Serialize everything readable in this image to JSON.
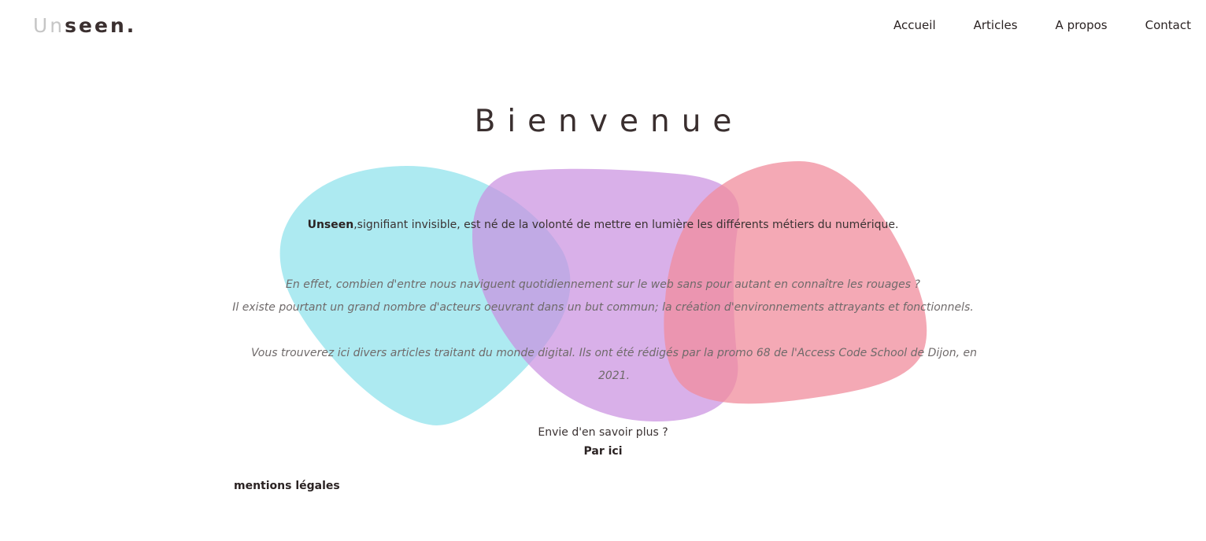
{
  "header": {
    "logo_light": "Un",
    "logo_dark": "seen",
    "logo_dot": ".",
    "nav": [
      "Accueil",
      "Articles",
      "A propos",
      "Contact"
    ]
  },
  "hero": {
    "title": "Bienvenue",
    "intro_brand": "Unseen",
    "intro_rest": ",signifiant invisible, est né de la volonté de mettre en lumière les différents métiers du numérique.",
    "para1_line1": "En effet, combien d'entre nous naviguent quotidiennement sur le web sans pour autant en connaître les rouages ?",
    "para1_line2": "Il existe pourtant un grand nombre d'acteurs oeuvrant dans un but commun; la création d'environnements attrayants et fonctionnels.",
    "para2": "Vous trouverez ici divers articles traitant du monde digital. Ils ont été rédigés par la promo 68 de l'Access Code School de Dijon, en 2021.",
    "more_question": "Envie d'en savoir plus ?",
    "more_link": "Par ici"
  },
  "footer": {
    "legal": "mentions légales"
  },
  "colors": {
    "blob_cyan": "#9fe6ef",
    "blob_purple": "#d3a6e4",
    "blob_pink": "#f29aa8",
    "text_dark": "#2b2323",
    "logo_light": "#c6c6c6"
  }
}
